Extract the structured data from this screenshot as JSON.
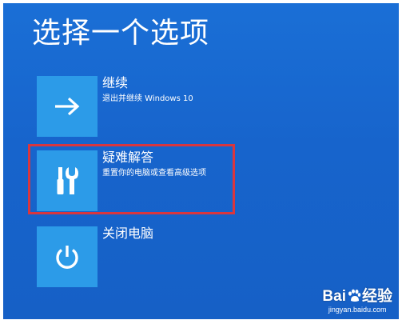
{
  "screen": {
    "title": "选择一个选项",
    "background_color": "#1764cc",
    "tile_color": "#2c9be8",
    "highlight_color": "#d9363e"
  },
  "options": [
    {
      "title": "继续",
      "description": "退出并继续 Windows 10",
      "icon": "arrow-right-icon"
    },
    {
      "title": "疑难解答",
      "description": "重置你的电脑或查看高级选项",
      "icon": "tools-icon",
      "highlighted": true
    },
    {
      "title": "关闭电脑",
      "description": "",
      "icon": "power-icon"
    }
  ],
  "watermark": {
    "logo_left": "Bai",
    "logo_right": "经验",
    "url": "jingyan.baidu.com",
    "icon": "paw-icon"
  }
}
